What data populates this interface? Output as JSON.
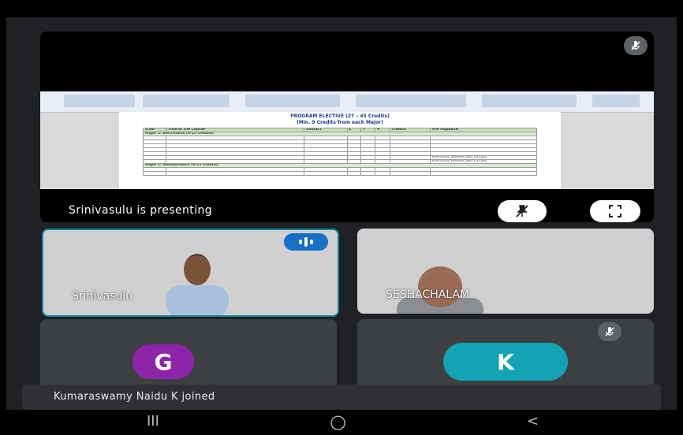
{
  "presentation": {
    "caption": "Srinivasulu is presenting",
    "doc_title": "PROGRAM ELECTIVE (27 – 45 Credits)",
    "doc_subtitle": "(Min. 9 Credits from each Major)",
    "header": [
      "S.No",
      "Title of the Course",
      "Contact",
      "L",
      "T",
      "P",
      "Credits",
      "Pre requisite"
    ],
    "major1": "Major 1: Electronics (9-15 Credits)",
    "major2": "Major 2: Mechatronics (9-15 Credits)",
    "prereq_a": "Electronic Devices and Circuits",
    "prereq_b": "Electronic Devices and Circuits"
  },
  "participants": [
    {
      "name": "Srinivasulu"
    },
    {
      "name": "SESHACHALAM"
    },
    {
      "initial": "G",
      "color": "#8e24aa"
    },
    {
      "initial": "K",
      "color": "#12a4b4"
    }
  ],
  "toast": "Kumaraswamy Naidu K joined",
  "nav": {
    "recents": "III",
    "home": "○",
    "back": "<"
  },
  "icons": [
    "mic-off-icon",
    "unpin-icon",
    "fullscreen-icon",
    "speaking-indicator-icon"
  ]
}
